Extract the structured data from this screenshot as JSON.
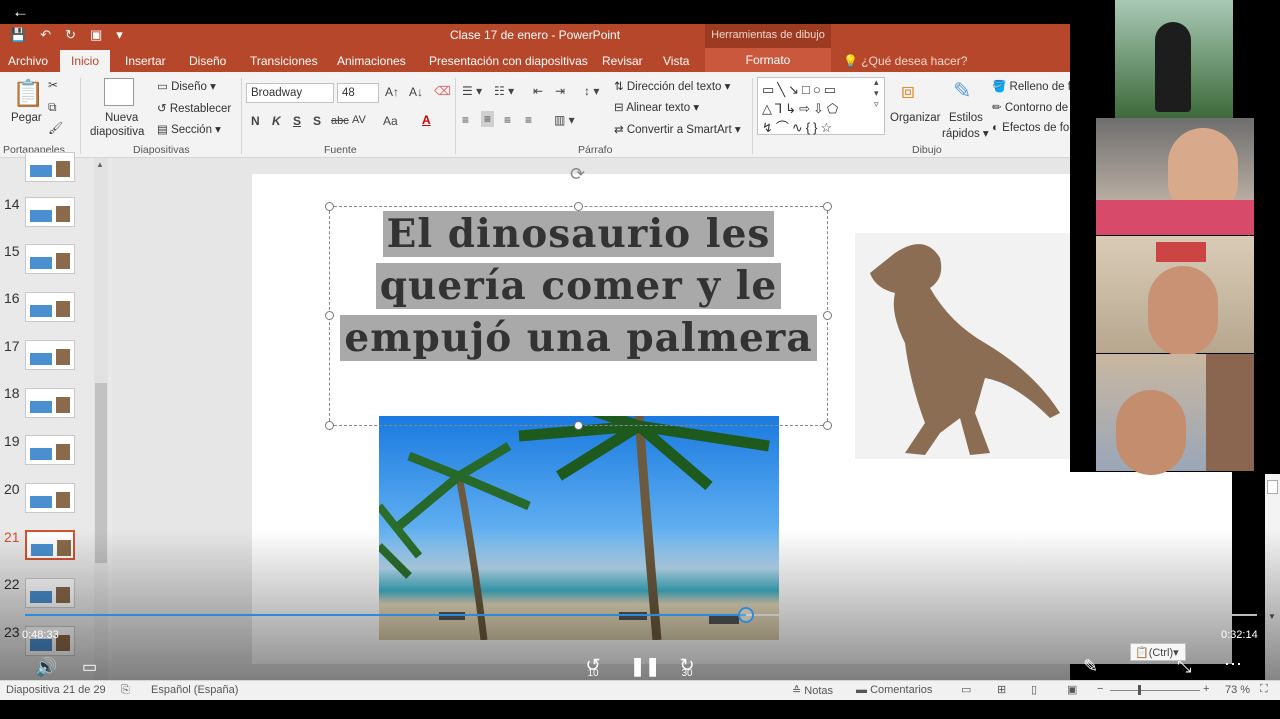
{
  "window": {
    "title": "Clase 17 de enero - PowerPoint",
    "contextual": "Herramientas de dibujo"
  },
  "tabs": {
    "file": "Archivo",
    "home": "Inicio",
    "insert": "Insertar",
    "design": "Diseño",
    "transitions": "Transiciones",
    "animations": "Animaciones",
    "slideshow": "Presentación con diapositivas",
    "review": "Revisar",
    "view": "Vista",
    "format": "Formato",
    "tell": "¿Qué desea hacer?"
  },
  "ribbon": {
    "clipboard": {
      "paste": "Pegar",
      "label": "Portapapeles"
    },
    "slides": {
      "new": "Nueva",
      "new2": "diapositiva",
      "layout": "Diseño",
      "reset": "Restablecer",
      "section": "Sección",
      "label": "Diapositivas"
    },
    "font": {
      "name": "Broadway",
      "size": "48",
      "label": "Fuente",
      "bold": "N",
      "italic": "K",
      "underline": "S",
      "shadow": "S",
      "strike": "abc",
      "spacing": "AV",
      "case": "Aa",
      "color": "A"
    },
    "paragraph": {
      "direction": "Dirección del texto",
      "align": "Alinear texto",
      "smartart": "Convertir a SmartArt",
      "label": "Párrafo"
    },
    "drawing": {
      "arrange": "Organizar",
      "styles": "Estilos",
      "styles2": "rápidos",
      "fill": "Relleno de fo",
      "outline": "Contorno de",
      "effects": "Efectos de fo",
      "label": "Dibujo"
    }
  },
  "thumbnails": [
    {
      "n": "14"
    },
    {
      "n": "15"
    },
    {
      "n": "16"
    },
    {
      "n": "17"
    },
    {
      "n": "18"
    },
    {
      "n": "19"
    },
    {
      "n": "20"
    },
    {
      "n": "21"
    },
    {
      "n": "22"
    },
    {
      "n": "23"
    }
  ],
  "slide": {
    "title": "El dinosaurio les quería comer y le empujó una palmera"
  },
  "player": {
    "elapsed": "0:48:33",
    "remaining": "0:32:14",
    "progress_percent": 58.5,
    "rewind": "10",
    "forward": "30"
  },
  "status": {
    "slide": "Diapositiva 21 de 29",
    "lang": "Español (España)",
    "notes": "Notas",
    "comments": "Comentarios",
    "zoom": "73 %",
    "ctrl": "(Ctrl)"
  }
}
